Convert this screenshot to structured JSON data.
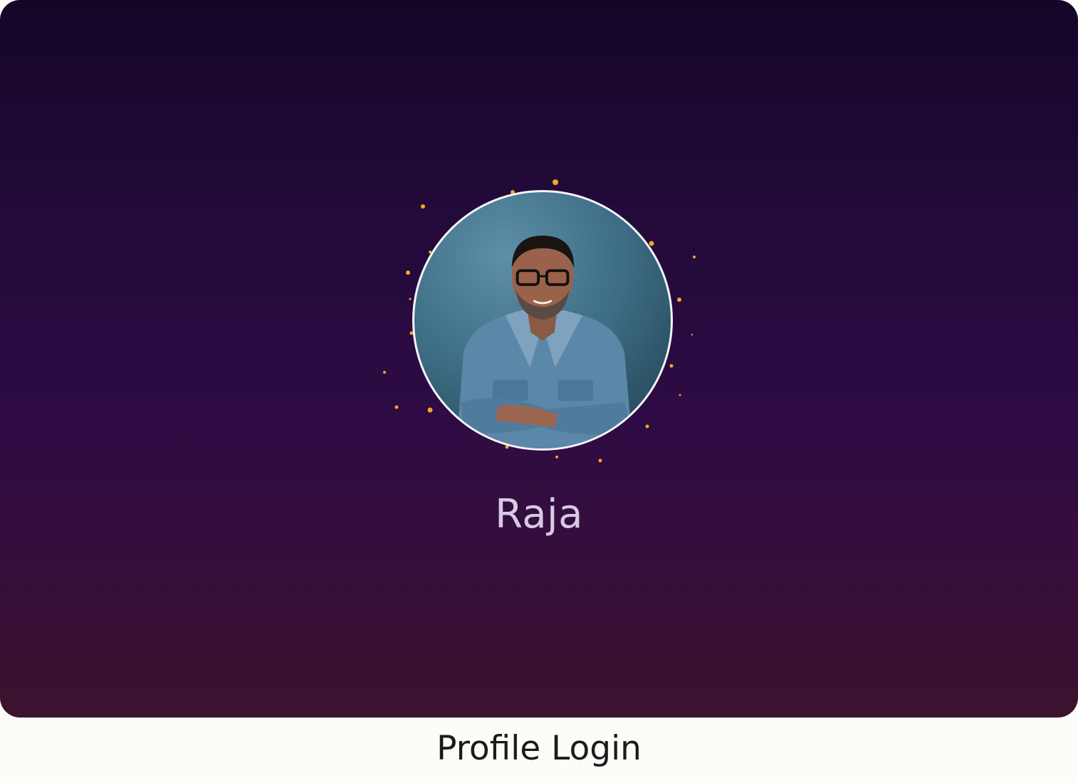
{
  "profile": {
    "name": "Raja",
    "avatar_icon": "user-avatar-photo"
  },
  "caption": "Profile Login",
  "colors": {
    "background_top": "#150628",
    "background_bottom": "#3c122e",
    "sparkle": "#f5a623",
    "avatar_ring": "#f5f5f7",
    "name_text": "#d8c9e4",
    "caption_text": "#1b1b1b",
    "page_background": "#fdfcf8"
  }
}
